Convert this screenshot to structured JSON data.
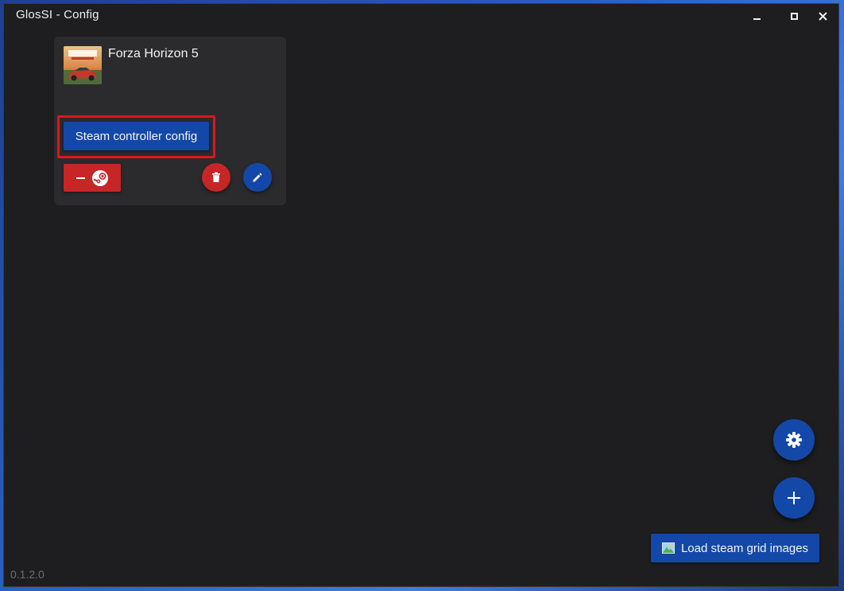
{
  "window": {
    "title": "GlosSI - Config"
  },
  "window_controls": [
    "minimize-icon",
    "maximize-icon",
    "close-icon"
  ],
  "shortcut_card": {
    "game_title": "Forza Horizon 5",
    "steam_config_label": "Steam controller config",
    "remove_from_steam_icons": [
      "minus-icon",
      "steam-icon"
    ],
    "delete_icon": "trash-icon",
    "edit_icon": "pencil-icon",
    "highlight_color": "#e1151b"
  },
  "floating_actions": {
    "settings_icon": "gear-icon",
    "add_icon": "plus-icon"
  },
  "load_grid": {
    "icon": "image-icon",
    "label": "Load steam grid images"
  },
  "footer": {
    "version": "0.1.2.0"
  },
  "colors": {
    "background": "#1e1e20",
    "card": "#2b2b2e",
    "primary": "#1448a8",
    "danger": "#c62626"
  }
}
